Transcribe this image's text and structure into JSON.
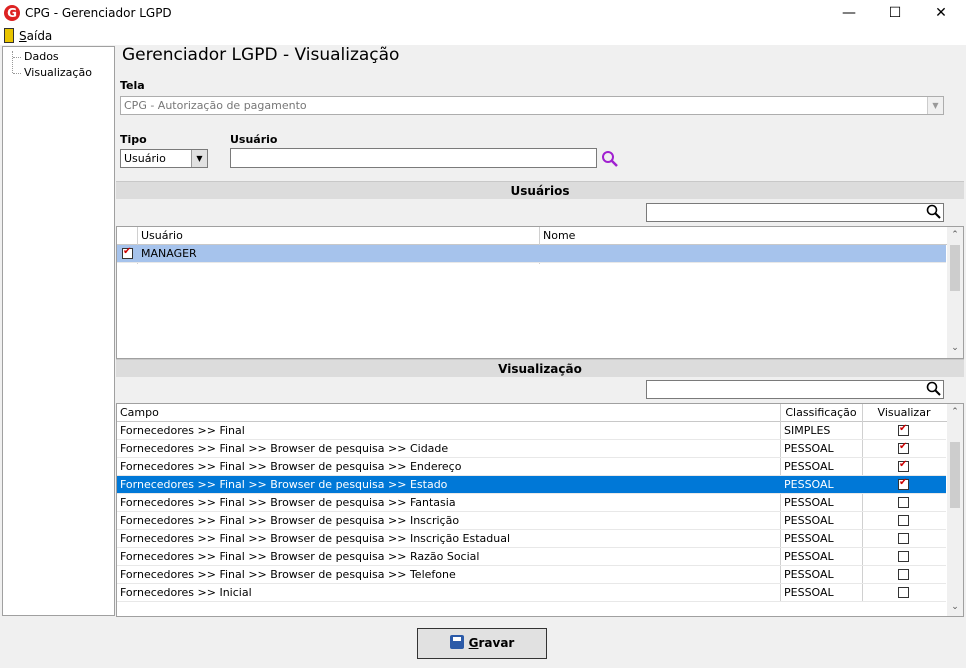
{
  "window": {
    "title": "CPG - Gerenciador LGPD",
    "minimize": "—",
    "maximize": "☐",
    "close": "✕"
  },
  "menu": {
    "saida_first": "S",
    "saida_rest": "aída"
  },
  "tree": {
    "items": [
      "Dados",
      "Visualização"
    ]
  },
  "page": {
    "title": "Gerenciador LGPD - Visualização"
  },
  "tela": {
    "label": "Tela",
    "value": "CPG - Autorização de pagamento"
  },
  "tipo": {
    "label": "Tipo",
    "value": "Usuário"
  },
  "usuario": {
    "label": "Usuário",
    "value": ""
  },
  "usuarios_section": {
    "title": "Usuários",
    "search_value": "",
    "columns": [
      "Usuário",
      "Nome"
    ],
    "rows": [
      {
        "checked": true,
        "usuario": "MANAGER",
        "nome": ""
      }
    ]
  },
  "visualizacao_section": {
    "title": "Visualização",
    "search_value": "",
    "columns": [
      "Campo",
      "Classificação",
      "Visualizar"
    ],
    "rows": [
      {
        "campo": "Fornecedores >> Final",
        "classificacao": "SIMPLES",
        "visualizar": true
      },
      {
        "campo": "Fornecedores >> Final >> Browser de pesquisa >> Cidade",
        "classificacao": "PESSOAL",
        "visualizar": true
      },
      {
        "campo": "Fornecedores >> Final >> Browser de pesquisa >> Endereço",
        "classificacao": "PESSOAL",
        "visualizar": true
      },
      {
        "campo": "Fornecedores >> Final >> Browser de pesquisa >> Estado",
        "classificacao": "PESSOAL",
        "visualizar": true,
        "selected": true
      },
      {
        "campo": "Fornecedores >> Final >> Browser de pesquisa >> Fantasia",
        "classificacao": "PESSOAL",
        "visualizar": false
      },
      {
        "campo": "Fornecedores >> Final >> Browser de pesquisa >> Inscrição",
        "classificacao": "PESSOAL",
        "visualizar": false
      },
      {
        "campo": "Fornecedores >> Final >> Browser de pesquisa >> Inscrição Estadual",
        "classificacao": "PESSOAL",
        "visualizar": false
      },
      {
        "campo": "Fornecedores >> Final >> Browser de pesquisa >> Razão Social",
        "classificacao": "PESSOAL",
        "visualizar": false
      },
      {
        "campo": "Fornecedores >> Final >> Browser de pesquisa >> Telefone",
        "classificacao": "PESSOAL",
        "visualizar": false
      },
      {
        "campo": "Fornecedores >> Inicial",
        "classificacao": "PESSOAL",
        "visualizar": false
      }
    ]
  },
  "footer": {
    "save_first": "G",
    "save_rest": "ravar"
  }
}
